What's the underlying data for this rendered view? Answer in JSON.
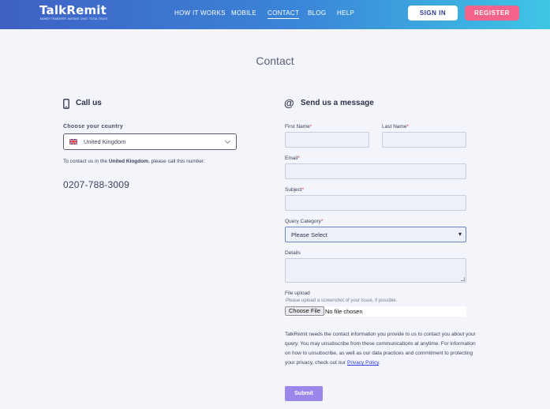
{
  "header": {
    "logo": {
      "name": "TalkRemit",
      "tagline": "MONEY TRANSFER. INSTANT CHAT. TOTAL TRUST."
    },
    "nav": [
      {
        "label": "HOW IT WORKS"
      },
      {
        "label": "MOBILE"
      },
      {
        "label": "CONTACT",
        "active": true
      },
      {
        "label": "BLOG"
      },
      {
        "label": "HELP"
      }
    ],
    "signin_label": "SIGN IN",
    "register_label": "REGISTER"
  },
  "page": {
    "title": "Contact"
  },
  "call_us": {
    "heading": "Call us",
    "icon": "phone-icon",
    "country_label": "Choose your country",
    "country_value": "United Kingdom",
    "contact_prefix": "To contact us in the ",
    "contact_country": "United Kingdom",
    "contact_suffix": ", please call this number:",
    "phone": "0207-788-3009"
  },
  "message": {
    "heading": "Send us a message",
    "icon": "at-icon",
    "first_name_label": "First Name",
    "last_name_label": "Last Name",
    "email_label": "Email",
    "subject_label": "Subject",
    "query_label": "Query Category",
    "query_value": "Please Select",
    "details_label": "Details",
    "file_label": "File upload",
    "file_hint": "Please upload a screenshot of your issue, if possible.",
    "file_button": "Choose File",
    "file_status": "No file chosen",
    "required_mark": "*",
    "disclaimer": "TalkRemit needs the contact information you provide to us to contact you about your query. You may unsubscribe from these communications at anytime. For information on how to unsubscribe, as well as our data practices and commitment to protecting your privacy, check out our ",
    "privacy_link": "Privacy Policy",
    "disclaimer_end": ".",
    "submit_label": "Submit"
  },
  "colors": {
    "header_gradient": [
      "#3f61c4",
      "#3fc6e6"
    ],
    "register": "#f4648a",
    "submit": "#9b87ec",
    "background": "#f4f5fa"
  }
}
